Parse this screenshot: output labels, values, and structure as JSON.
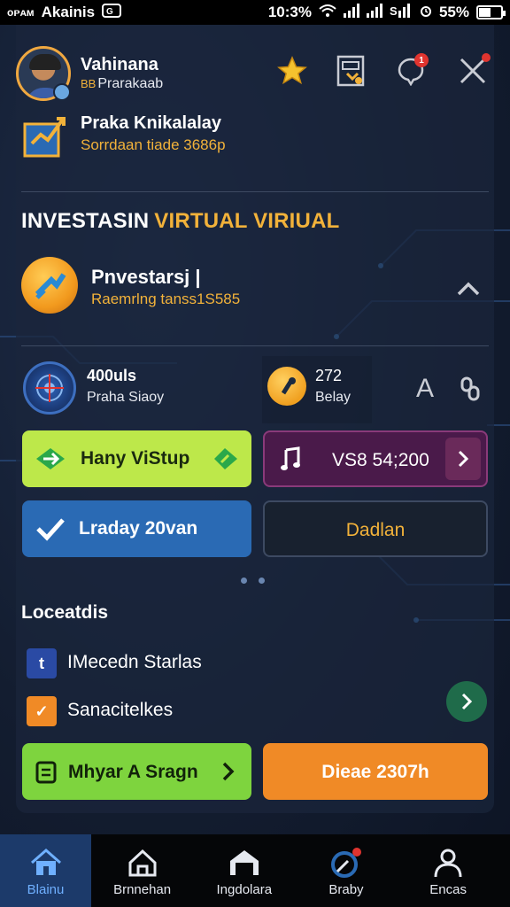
{
  "status_bar": {
    "carrier": "Akainis",
    "carrier_prefix": "ᴏᴘᴀᴍ",
    "time": "10:3%",
    "battery": "55%",
    "battery_level": 0.55
  },
  "profile": {
    "name": "Vahinana",
    "tag": "BB",
    "subtitle": "Prarakaab",
    "notification_count": "1"
  },
  "sub_profile": {
    "title": "Praka Knikalalay",
    "subtitle": "Sorrdaan tiade 3686p"
  },
  "section": {
    "title": "INVESTASIN",
    "accent": "VIRTUAL VIRIUAL"
  },
  "investment": {
    "title": "Pnvestarsj |",
    "subtitle": "Raemrlng tanss1S585"
  },
  "stats": {
    "stat1_value": "400uls",
    "stat1_label": "Praha Siaoy",
    "stat2_value": "272",
    "stat2_label": "Belay",
    "stat_letter": "A"
  },
  "buttons": {
    "green1": "Hany ViStup",
    "purple": "VS8 54;200",
    "blue": "Lraday 20van",
    "dark": "Dadlan",
    "green2": "Mhyar A Sragn",
    "orange": "Dieae 2307h"
  },
  "list": {
    "title": "Loceatdis",
    "items": [
      {
        "icon_text": "t",
        "label": "IMecedn Starlas"
      },
      {
        "icon_text": "✓",
        "label": "Sanacitelkes"
      }
    ]
  },
  "bottom_nav": [
    {
      "label": "Blainu",
      "icon": "home-icon"
    },
    {
      "label": "Brnnehan",
      "icon": "house-outline-icon"
    },
    {
      "label": "Ingdolara",
      "icon": "garage-icon"
    },
    {
      "label": "Braby",
      "icon": "compass-icon"
    },
    {
      "label": "Encas",
      "icon": "person-icon"
    }
  ],
  "colors": {
    "accent": "#f2b23a",
    "green": "#bde84a",
    "blue": "#2a6ab4",
    "orange": "#f08a26",
    "purple": "#4a1a4a"
  }
}
